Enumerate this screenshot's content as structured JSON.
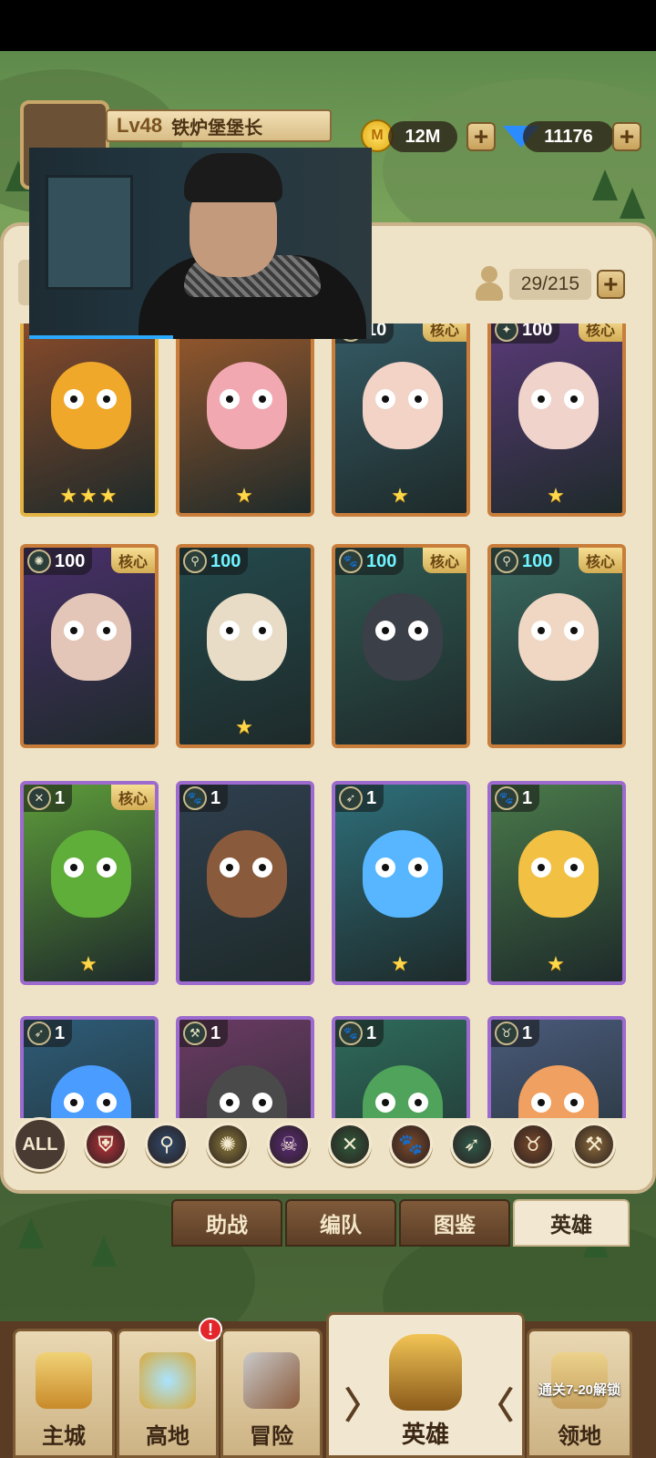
{
  "player": {
    "level": "Lv48",
    "title": "铁炉堡堡长"
  },
  "resources": {
    "gold": "12M",
    "gems": "11176",
    "gold_icon_glyph": "M",
    "plus": "+"
  },
  "roster": {
    "capacity": "29/215"
  },
  "core_label": "核心",
  "heroes": [
    {
      "level": "",
      "core": false,
      "stars": "★★★",
      "frame": "gold",
      "bg": "#8a4b2a",
      "face": "#f0a82a",
      "row": 0,
      "col": 0,
      "cls": "🐾"
    },
    {
      "level": "",
      "core": false,
      "stars": "★",
      "frame": "bronze",
      "bg": "#9b5a2d",
      "face": "#f2a8b0",
      "row": 0,
      "col": 1,
      "cls": "✦"
    },
    {
      "level": "10",
      "core": true,
      "stars": "★",
      "frame": "bronze",
      "bg": "#355c66",
      "face": "#f2d3c6",
      "row": 0,
      "col": 2,
      "cls": "✦"
    },
    {
      "level": "100",
      "core": true,
      "stars": "★",
      "frame": "bronze",
      "bg": "#5b3a7a",
      "face": "#f0d4cc",
      "row": 0,
      "col": 3,
      "cls": "✦"
    },
    {
      "level": "100",
      "core": true,
      "stars": "",
      "frame": "bronze",
      "bg": "#4a2f6b",
      "face": "#e3c6b8",
      "row": 1,
      "col": 0,
      "cls": "✺",
      "cyan": false
    },
    {
      "level": "100",
      "core": false,
      "stars": "★",
      "frame": "bronze",
      "bg": "#244a4d",
      "face": "#e8dcc6",
      "row": 1,
      "col": 1,
      "cls": "⚲",
      "cyan": true
    },
    {
      "level": "100",
      "core": true,
      "stars": "",
      "frame": "bronze",
      "bg": "#2f5a52",
      "face": "#3b3f47",
      "row": 1,
      "col": 2,
      "cls": "🐾",
      "cyan": true
    },
    {
      "level": "100",
      "core": true,
      "stars": "",
      "frame": "bronze",
      "bg": "#3b6b62",
      "face": "#f0d7c3",
      "row": 1,
      "col": 3,
      "cls": "⚲",
      "cyan": true
    },
    {
      "level": "1",
      "core": true,
      "stars": "★",
      "frame": "purple",
      "bg": "#5d9c3a",
      "face": "#5fae3a",
      "row": 2,
      "col": 0,
      "cls": "✕"
    },
    {
      "level": "1",
      "core": false,
      "stars": "",
      "frame": "purple",
      "bg": "#2f3f4e",
      "face": "#8a5a3c",
      "row": 2,
      "col": 1,
      "cls": "🐾"
    },
    {
      "level": "1",
      "core": false,
      "stars": "★",
      "frame": "purple",
      "bg": "#2e6f7a",
      "face": "#57b6ff",
      "row": 2,
      "col": 2,
      "cls": "➶"
    },
    {
      "level": "1",
      "core": false,
      "stars": "★",
      "frame": "purple",
      "bg": "#4a7a4a",
      "face": "#f2c043",
      "row": 2,
      "col": 3,
      "cls": "🐾"
    },
    {
      "level": "1",
      "core": false,
      "stars": "",
      "frame": "purple",
      "bg": "#2e5c78",
      "face": "#4a9cff",
      "row": 3,
      "col": 0,
      "cls": "➶"
    },
    {
      "level": "1",
      "core": false,
      "stars": "",
      "frame": "purple",
      "bg": "#6b3a63",
      "face": "#4a4a4a",
      "row": 3,
      "col": 1,
      "cls": "⚒"
    },
    {
      "level": "1",
      "core": false,
      "stars": "",
      "frame": "purple",
      "bg": "#2e6b5a",
      "face": "#4fa35a",
      "row": 3,
      "col": 2,
      "cls": "🐾"
    },
    {
      "level": "1",
      "core": false,
      "stars": "",
      "frame": "purple",
      "bg": "#4a5a7a",
      "face": "#f0a060",
      "row": 3,
      "col": 3,
      "cls": "♉"
    }
  ],
  "filters": {
    "all": "ALL",
    "items": [
      {
        "name": "shield-icon",
        "glyph": "⛨",
        "color": "#b6323a"
      },
      {
        "name": "staff-icon",
        "glyph": "⚲",
        "color": "#2f4a6b"
      },
      {
        "name": "holy-icon",
        "glyph": "✺",
        "color": "#8a7a3a"
      },
      {
        "name": "skull-icon",
        "glyph": "☠",
        "color": "#5a2a78"
      },
      {
        "name": "crossed-daggers-icon",
        "glyph": "✕",
        "color": "#2f5a3a"
      },
      {
        "name": "paw-icon",
        "glyph": "🐾",
        "color": "#7a4a2a"
      },
      {
        "name": "bow-icon",
        "glyph": "➶",
        "color": "#2f5a4a"
      },
      {
        "name": "bull-icon",
        "glyph": "♉",
        "color": "#7a4a2a"
      },
      {
        "name": "hammer-icon",
        "glyph": "⚒",
        "color": "#8a6a3a"
      }
    ]
  },
  "subtabs": [
    "助战",
    "编队",
    "图鉴",
    "英雄"
  ],
  "nav": {
    "main_city": "主城",
    "highland": "高地",
    "adventure": "冒险",
    "heroes": "英雄",
    "territory": "领地",
    "territory_lock": "通关7-20解锁",
    "notification": "!",
    "arrow_left": "〉",
    "arrow_right": "〈"
  },
  "video": {
    "progress": 0.42
  }
}
